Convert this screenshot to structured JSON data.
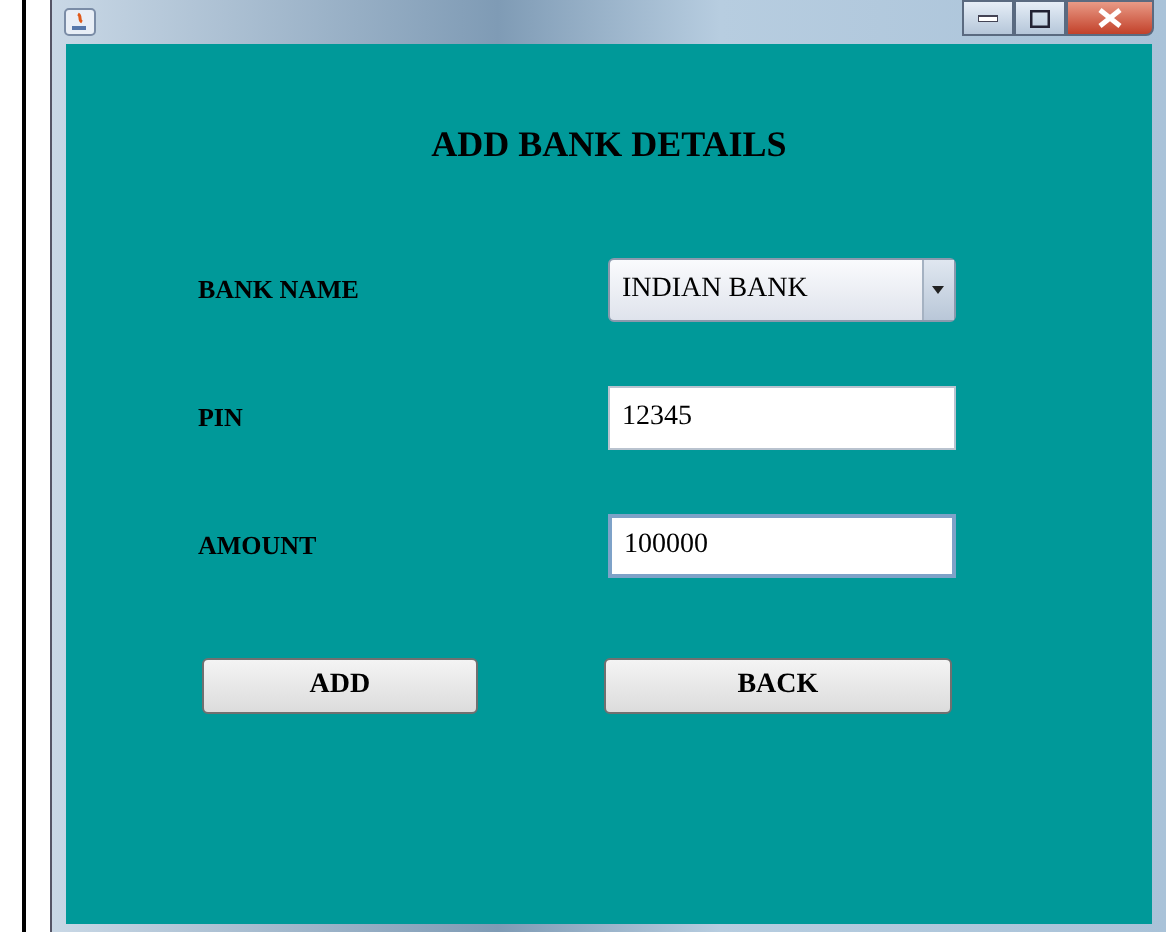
{
  "heading": "ADD BANK DETAILS",
  "fields": [
    {
      "kind": "dropdown",
      "label": "BANK NAME",
      "value": "INDIAN BANK",
      "focused": false
    },
    {
      "kind": "text",
      "label": "PIN",
      "value": "12345",
      "focused": false
    },
    {
      "kind": "text",
      "label": "AMOUNT",
      "value": "100000",
      "focused": true
    }
  ],
  "buttons": [
    "ADD",
    "BACK"
  ]
}
